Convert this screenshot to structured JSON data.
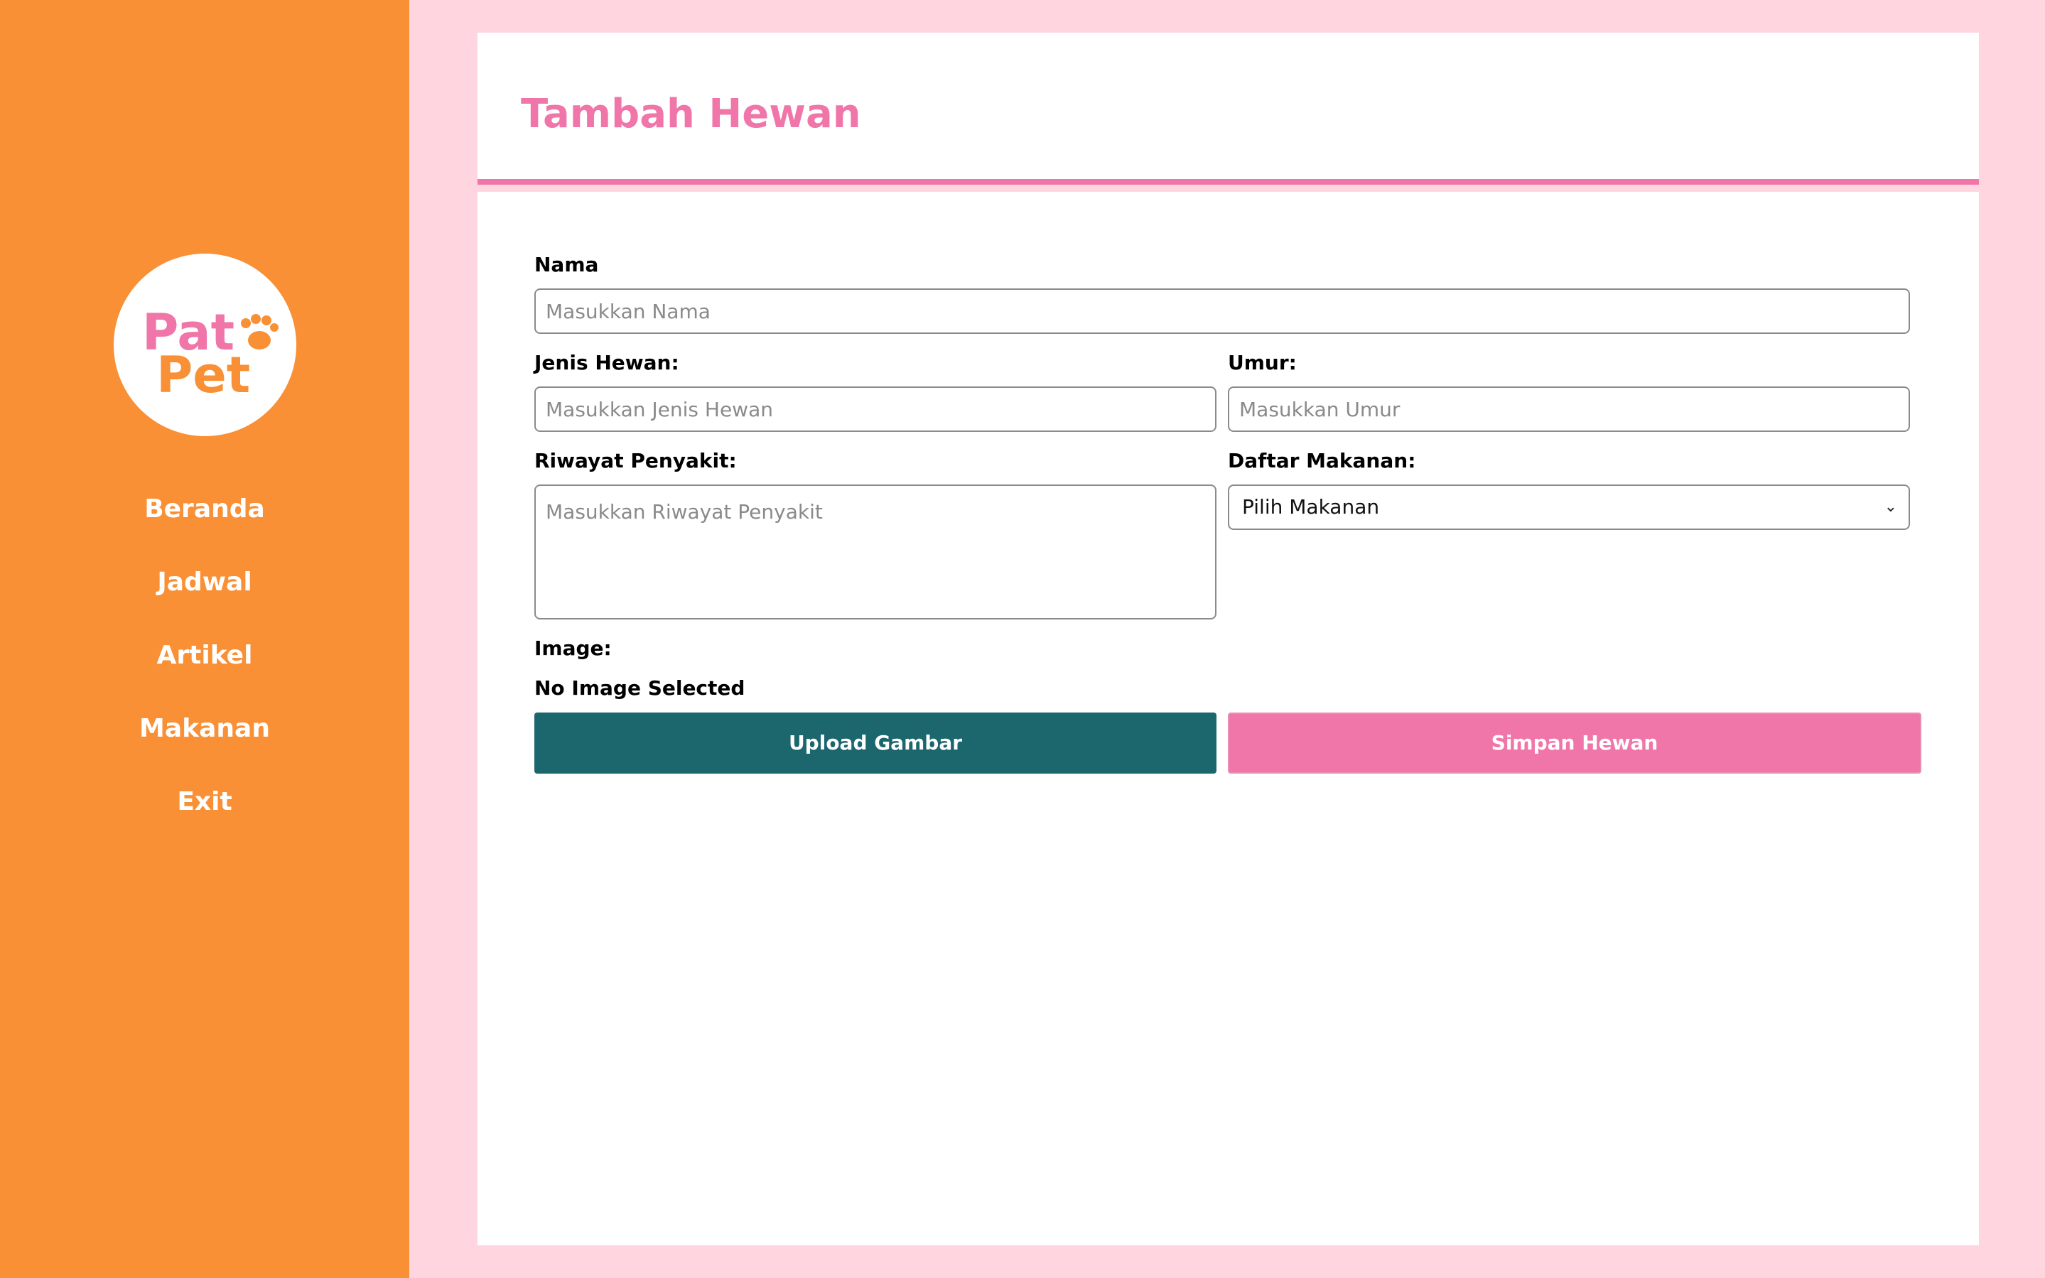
{
  "sidebar": {
    "logo_text": "Pat Pet",
    "nav": [
      {
        "label": "Beranda"
      },
      {
        "label": "Jadwal"
      },
      {
        "label": "Artikel"
      },
      {
        "label": "Makanan"
      },
      {
        "label": "Exit"
      }
    ]
  },
  "header": {
    "title": "Tambah Hewan"
  },
  "form": {
    "nama": {
      "label": "Nama",
      "placeholder": "Masukkan Nama"
    },
    "jenis": {
      "label": "Jenis Hewan:",
      "placeholder": "Masukkan Jenis Hewan"
    },
    "umur": {
      "label": "Umur:",
      "placeholder": "Masukkan Umur"
    },
    "riwayat": {
      "label": "Riwayat Penyakit:",
      "placeholder": "Masukkan Riwayat Penyakit"
    },
    "makanan": {
      "label": "Daftar Makanan:",
      "selected": "Pilih Makanan"
    },
    "image": {
      "label": "Image:",
      "status": "No Image Selected"
    },
    "upload_button": "Upload Gambar",
    "save_button": "Simpan Hewan"
  },
  "colors": {
    "sidebar_bg": "#f99035",
    "page_bg": "#ffd6df",
    "accent_pink": "#f076a9",
    "upload_teal": "#1c666e"
  },
  "icons": {
    "logo": "paw-icon",
    "select": "chevron-down-icon"
  }
}
